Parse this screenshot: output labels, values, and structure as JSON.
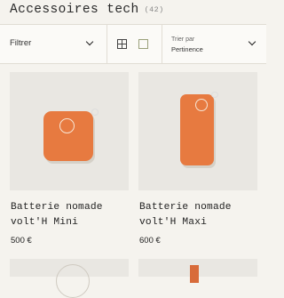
{
  "page": {
    "title": "Accessoires tech",
    "count": "(42)"
  },
  "toolbar": {
    "filter_label": "Filtrer",
    "sort_caption": "Trier par",
    "sort_value": "Pertinence"
  },
  "products": [
    {
      "name": "Batterie nomade volt'H Mini",
      "price": "500 €",
      "color": "#e77a40"
    },
    {
      "name": "Batterie nomade volt'H Maxi",
      "price": "600 €",
      "color": "#e77a40"
    }
  ],
  "icons": {
    "grid_view": "grid-4-icon",
    "single_view": "square-icon",
    "chevron": "chevron-down-icon"
  }
}
